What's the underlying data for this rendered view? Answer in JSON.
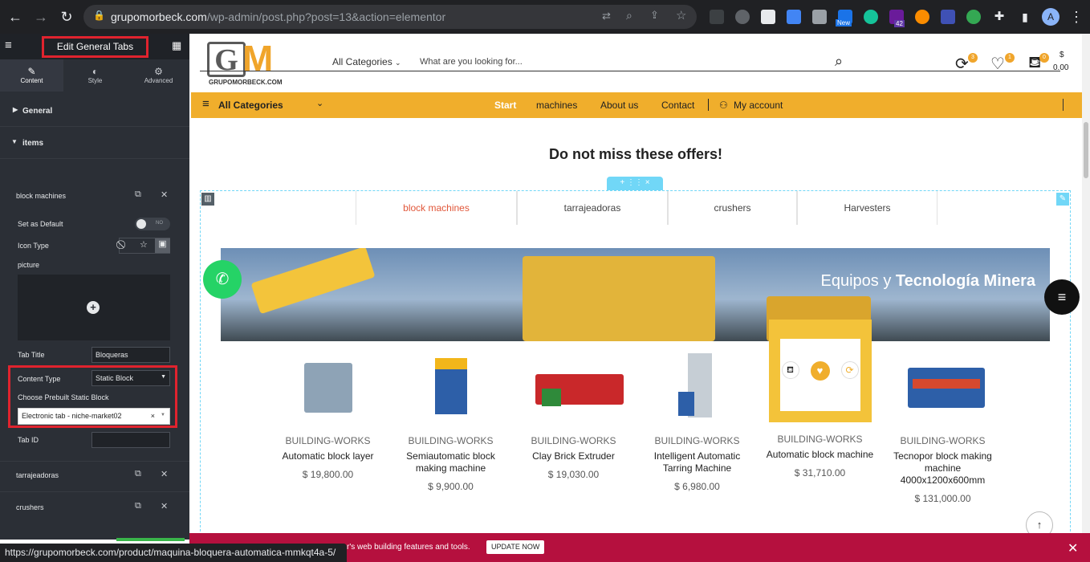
{
  "browser": {
    "url_host": "grupomorbeck.com",
    "url_path": "/wp-admin/post.php?post=13&action=elementor",
    "profile_initial": "A",
    "extension_badge_new": "New",
    "extension_badge_count": "42"
  },
  "panel": {
    "title": "Edit General Tabs",
    "tabs": [
      {
        "label": "Content",
        "icon": "pencil-icon"
      },
      {
        "label": "Style",
        "icon": "half-circle-icon"
      },
      {
        "label": "Advanced",
        "icon": "gear-icon"
      }
    ],
    "section_general": "General",
    "section_items": "items",
    "item_title": "block machines",
    "set_default_label": "Set as Default",
    "toggle_text": "NO",
    "icon_type_label": "Icon Type",
    "picture_label": "picture",
    "tab_title_label": "Tab Title",
    "tab_title_value": "Bloqueras",
    "content_type_label": "Content Type",
    "content_type_value": "Static Block",
    "prebuilt_label": "Choose Prebuilt Static Block",
    "prebuilt_value": "Electronic tab - niche-market02",
    "tab_id_label": "Tab ID",
    "tab_id_value": "",
    "item2_title": "tarrajeadoras",
    "item3_title": "crushers"
  },
  "site": {
    "logo_text": "GRUPOMORBECK.COM",
    "logo_g": "G",
    "logo_m": "M",
    "category_select": "All Categories",
    "search_placeholder": "What are you looking for...",
    "compare_count": "3",
    "wishlist_count": "1",
    "cart_count": "0",
    "cart_currency": "$",
    "cart_total": "0.00",
    "nav": {
      "all_categories": "All Categories",
      "items": [
        "Start",
        "machines",
        "About us",
        "Contact"
      ],
      "account": "My account"
    },
    "offers_title": "Do not miss these offers!",
    "tabs": [
      "block machines",
      "tarrajeadoras",
      "crushers",
      "Harvesters"
    ],
    "banner_text_light": "Equipos y ",
    "banner_text_bold": "Tecnología Minera",
    "products": [
      {
        "category": "BUILDING-WORKS",
        "name": "Automatic block layer",
        "price": "$ 19,800.00"
      },
      {
        "category": "BUILDING-WORKS",
        "name": "Semiautomatic block making machine",
        "price": "$ 9,900.00"
      },
      {
        "category": "BUILDING-WORKS",
        "name": "Clay Brick Extruder",
        "price": "$ 19,030.00"
      },
      {
        "category": "BUILDING-WORKS",
        "name": "Intelligent Automatic Tarring Machine",
        "price": "$ 6,980.00"
      },
      {
        "category": "BUILDING-WORKS",
        "name": "Automatic block machine",
        "price": "$ 31,710.00"
      },
      {
        "category": "BUILDING-WORKS",
        "name": "Tecnopor block making machine 4000x1200x600mm",
        "price": "$ 131,000.00"
      }
    ]
  },
  "status_url": "https://grupomorbeck.com/product/maquina-bloquera-automatica-mmkqt4a-5/",
  "notice": {
    "text": "r's web building features and tools.",
    "button": "UPDATE NOW"
  },
  "colors": {
    "accent": "#f0ae2c",
    "active_tab": "#e1573a",
    "highlight_red": "#e0232e",
    "notice_bg": "#b5103e"
  }
}
